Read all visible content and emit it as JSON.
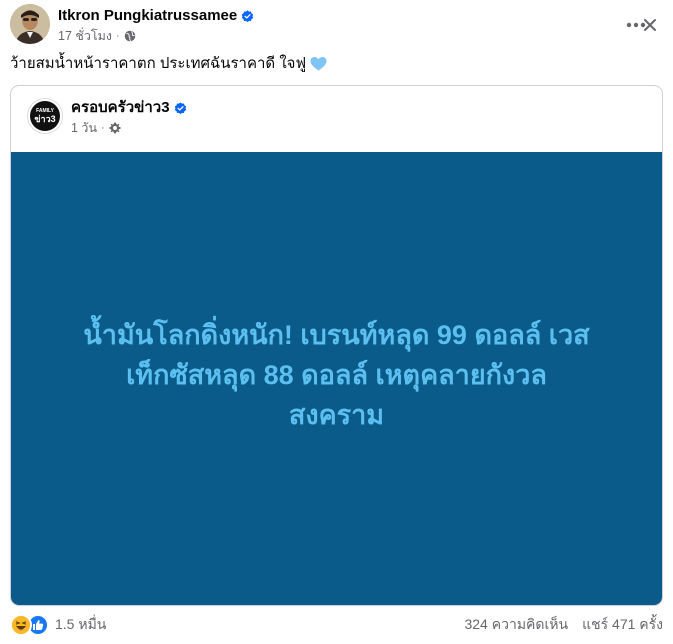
{
  "post": {
    "author_name": "Itkron Pungkiatrussamee",
    "timestamp": "17 ชั่วโมง",
    "separator": "·",
    "caption": "ว้ายสมน้ำหน้าราคาตก ประเทศฉันราคาดี ใจฟู",
    "icons": {
      "verified": "verified-badge-icon",
      "privacy": "globe-icon",
      "more": "more-horizontal-icon",
      "close": "close-icon",
      "heart": "blue-heart-icon"
    }
  },
  "shared": {
    "page_name": "ครอบครัวข่าว3",
    "timestamp": "1 วัน",
    "separator": "·",
    "logo_text_top": "FAMILY",
    "logo_text_bottom": "ข่าว3",
    "headline_line1": "น้ำมันโลกดิ่งหนัก! เบรนท์หลุด 99 ดอลล์ เวส",
    "headline_line2": "เท็กซัสหลุด 88 ดอลล์ เหตุคลายกังวล",
    "headline_line3": "สงคราม",
    "colors": {
      "background": "#0a5a8a",
      "headline": "#5bbfef"
    }
  },
  "footer": {
    "reaction_count": "1.5 หมื่น",
    "comments": "324 ความคิดเห็น",
    "shares": "แชร์ 471 ครั้ง",
    "reactions": [
      "haha",
      "like"
    ]
  },
  "colors": {
    "verified_blue": "#0866ff",
    "secondary_text": "#65676b",
    "heart": "#7fc4f5"
  }
}
